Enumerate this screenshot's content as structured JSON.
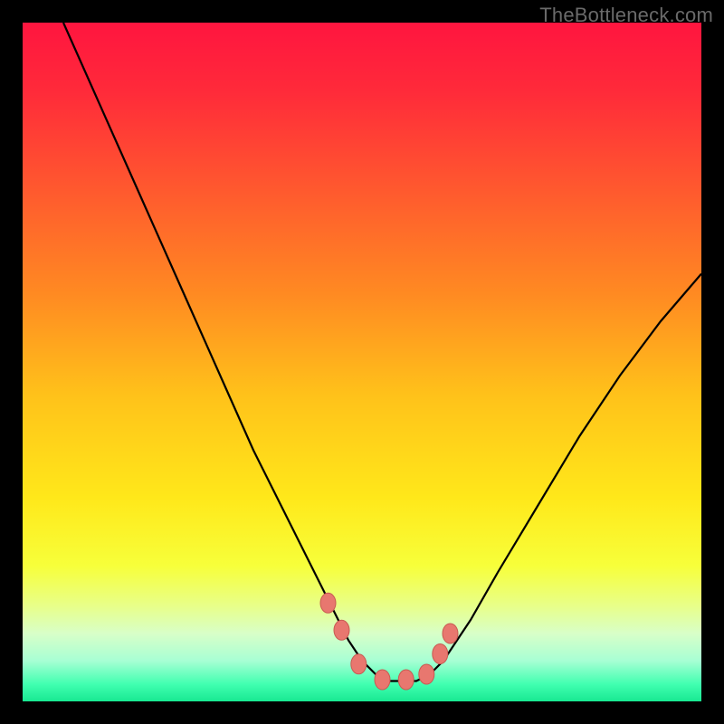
{
  "watermark": "TheBottleneck.com",
  "colors": {
    "frame": "#000000",
    "curve_stroke": "#000000",
    "marker_fill": "#e8776f",
    "marker_stroke": "#c85a52",
    "gradient_stops": [
      {
        "offset": 0.0,
        "color": "#ff153f"
      },
      {
        "offset": 0.1,
        "color": "#ff2a3a"
      },
      {
        "offset": 0.25,
        "color": "#ff5a2e"
      },
      {
        "offset": 0.4,
        "color": "#ff8a22"
      },
      {
        "offset": 0.55,
        "color": "#ffc21a"
      },
      {
        "offset": 0.7,
        "color": "#ffe81a"
      },
      {
        "offset": 0.8,
        "color": "#f7ff3a"
      },
      {
        "offset": 0.86,
        "color": "#e8ff8a"
      },
      {
        "offset": 0.9,
        "color": "#d8ffc8"
      },
      {
        "offset": 0.94,
        "color": "#a8ffd4"
      },
      {
        "offset": 0.975,
        "color": "#40ffb0"
      },
      {
        "offset": 1.0,
        "color": "#18e892"
      }
    ]
  },
  "chart_data": {
    "type": "line",
    "title": "",
    "xlabel": "",
    "ylabel": "",
    "xlim": [
      0,
      100
    ],
    "ylim": [
      0,
      100
    ],
    "grid": false,
    "legend": false,
    "series": [
      {
        "name": "bottleneck-curve",
        "x": [
          6,
          10,
          14,
          18,
          22,
          26,
          30,
          34,
          38,
          42,
          44,
          46,
          48,
          50,
          52,
          54,
          56,
          58,
          60,
          62,
          66,
          70,
          76,
          82,
          88,
          94,
          100
        ],
        "y": [
          100,
          91,
          82,
          73,
          64,
          55,
          46,
          37,
          29,
          21,
          17,
          13,
          9,
          6,
          4,
          3,
          3,
          3,
          4,
          6,
          12,
          19,
          29,
          39,
          48,
          56,
          63
        ]
      }
    ],
    "markers": {
      "name": "highlight-points",
      "x": [
        45,
        47,
        49.5,
        53,
        56.5,
        59.5,
        61.5,
        63
      ],
      "y": [
        14.5,
        10.5,
        5.5,
        3.2,
        3.2,
        4.0,
        7.0,
        10.0
      ]
    },
    "background": "vertical-gradient red→yellow→green (green at bottom)"
  }
}
